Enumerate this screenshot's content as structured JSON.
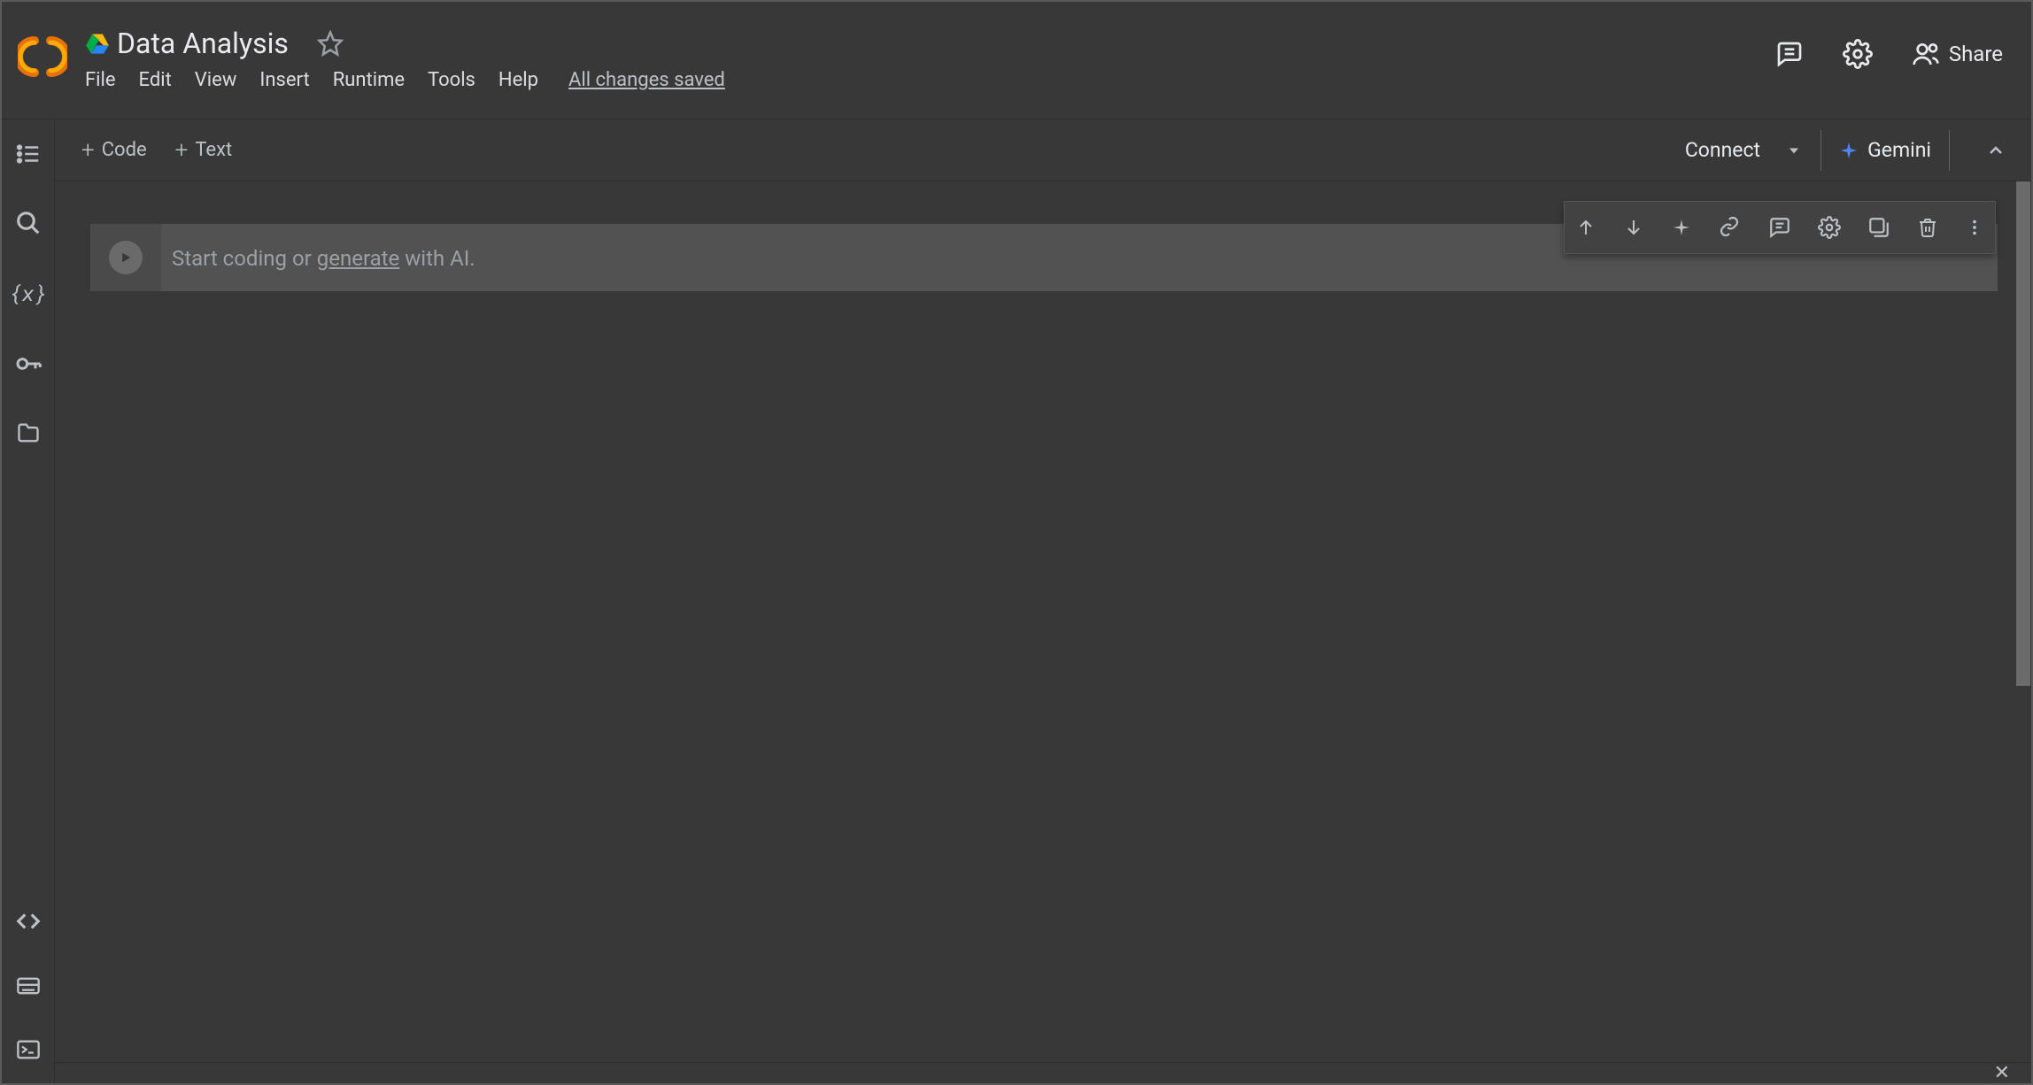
{
  "header": {
    "title": "Data Analysis",
    "menus": [
      "File",
      "Edit",
      "View",
      "Insert",
      "Runtime",
      "Tools",
      "Help"
    ],
    "saved_status": "All changes saved",
    "share_label": "Share"
  },
  "action_bar": {
    "code_label": "Code",
    "text_label": "Text",
    "connect_label": "Connect",
    "gemini_label": "Gemini"
  },
  "cell": {
    "placeholder_prefix": "Start coding or ",
    "placeholder_link": "generate",
    "placeholder_suffix": " with AI."
  }
}
